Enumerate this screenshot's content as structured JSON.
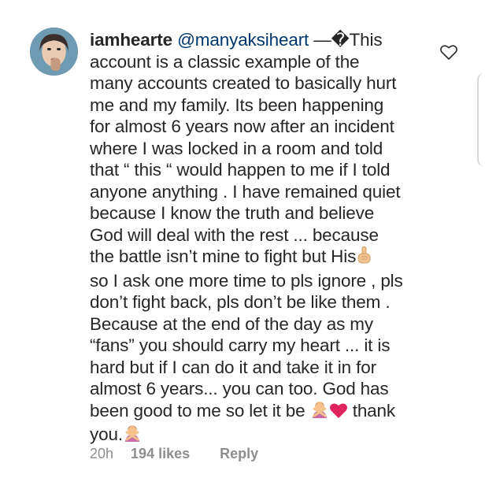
{
  "comment": {
    "username": "iamhearte",
    "mention": "@manyaksiheart",
    "lines": [
      "—�This",
      "account is a classic example of the",
      "many accounts created to basically hurt",
      "me and my family. Its been happening",
      "for almost 6 years now after an incident",
      "where I was locked in a room and told",
      "that “ this “ would happen to me if I told",
      "anyone anything . I have remained quiet",
      "because I know the truth and believe",
      "God will deal with the rest ... because",
      "the battle isn’t mine to fight but His",
      "so I ask one more time to pls ignore , pls",
      "don’t fight back, pls don’t be like them .",
      "Because at the end of the day as my",
      "“fans” you should carry my heart ... it is",
      "hard but if I can do it and take it in for",
      "almost 6 years... you can too. God has",
      "been good to me so let it be",
      "thank",
      "you."
    ],
    "emojis": [
      "pointing-up-emoji",
      "person-gesturing-no-emoji",
      "red-heart-emoji"
    ]
  },
  "meta": {
    "time": "20h",
    "likes": "194 likes",
    "reply": "Reply"
  },
  "colors": {
    "text": "#262626",
    "secondary": "#8e8e8e",
    "mention": "#00376b",
    "heart_emoji": "#e0245e"
  }
}
